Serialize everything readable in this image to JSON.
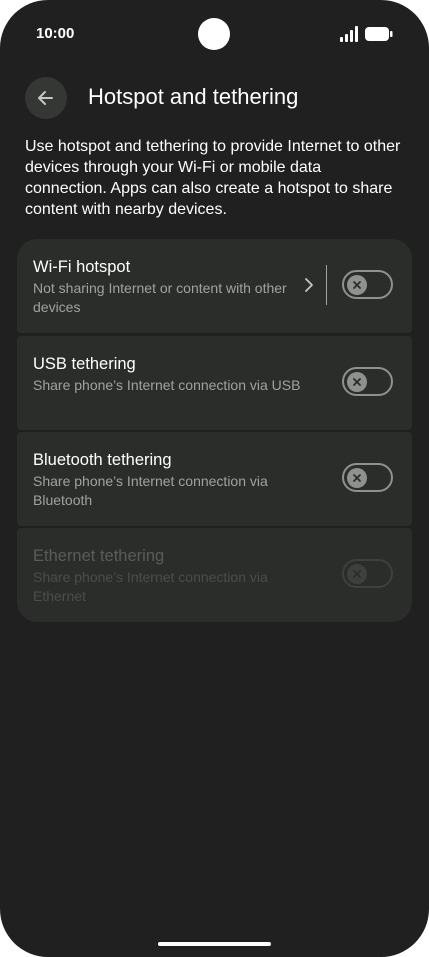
{
  "status_bar": {
    "time": "10:00",
    "signal_icon": "signal-icon",
    "battery_icon": "battery-icon"
  },
  "header": {
    "back_icon": "arrow-back-icon",
    "title": "Hotspot and tethering"
  },
  "description": "Use hotspot and tethering to provide Internet to other devices through your Wi-Fi or mobile data connection. Apps can also create a hotspot to share content with nearby devices.",
  "items": [
    {
      "title": "Wi-Fi hotspot",
      "subtitle": "Not sharing Internet or content with other devices",
      "enabled": true,
      "toggle_on": false,
      "has_chevron": true
    },
    {
      "title": "USB tethering",
      "subtitle": "Share phone’s Internet connection via USB",
      "enabled": true,
      "toggle_on": false
    },
    {
      "title": "Bluetooth tethering",
      "subtitle": "Share phone’s Internet connection via Bluetooth",
      "enabled": true,
      "toggle_on": false
    },
    {
      "title": "Ethernet tethering",
      "subtitle": "Share phone’s Internet connection via Ethernet",
      "enabled": false,
      "toggle_on": false
    }
  ],
  "colors": {
    "background": "#1f201f",
    "card": "#2b2d2b",
    "text_primary": "#ffffff",
    "text_secondary": "#9fa39f",
    "toggle_off": "#8e918e"
  }
}
